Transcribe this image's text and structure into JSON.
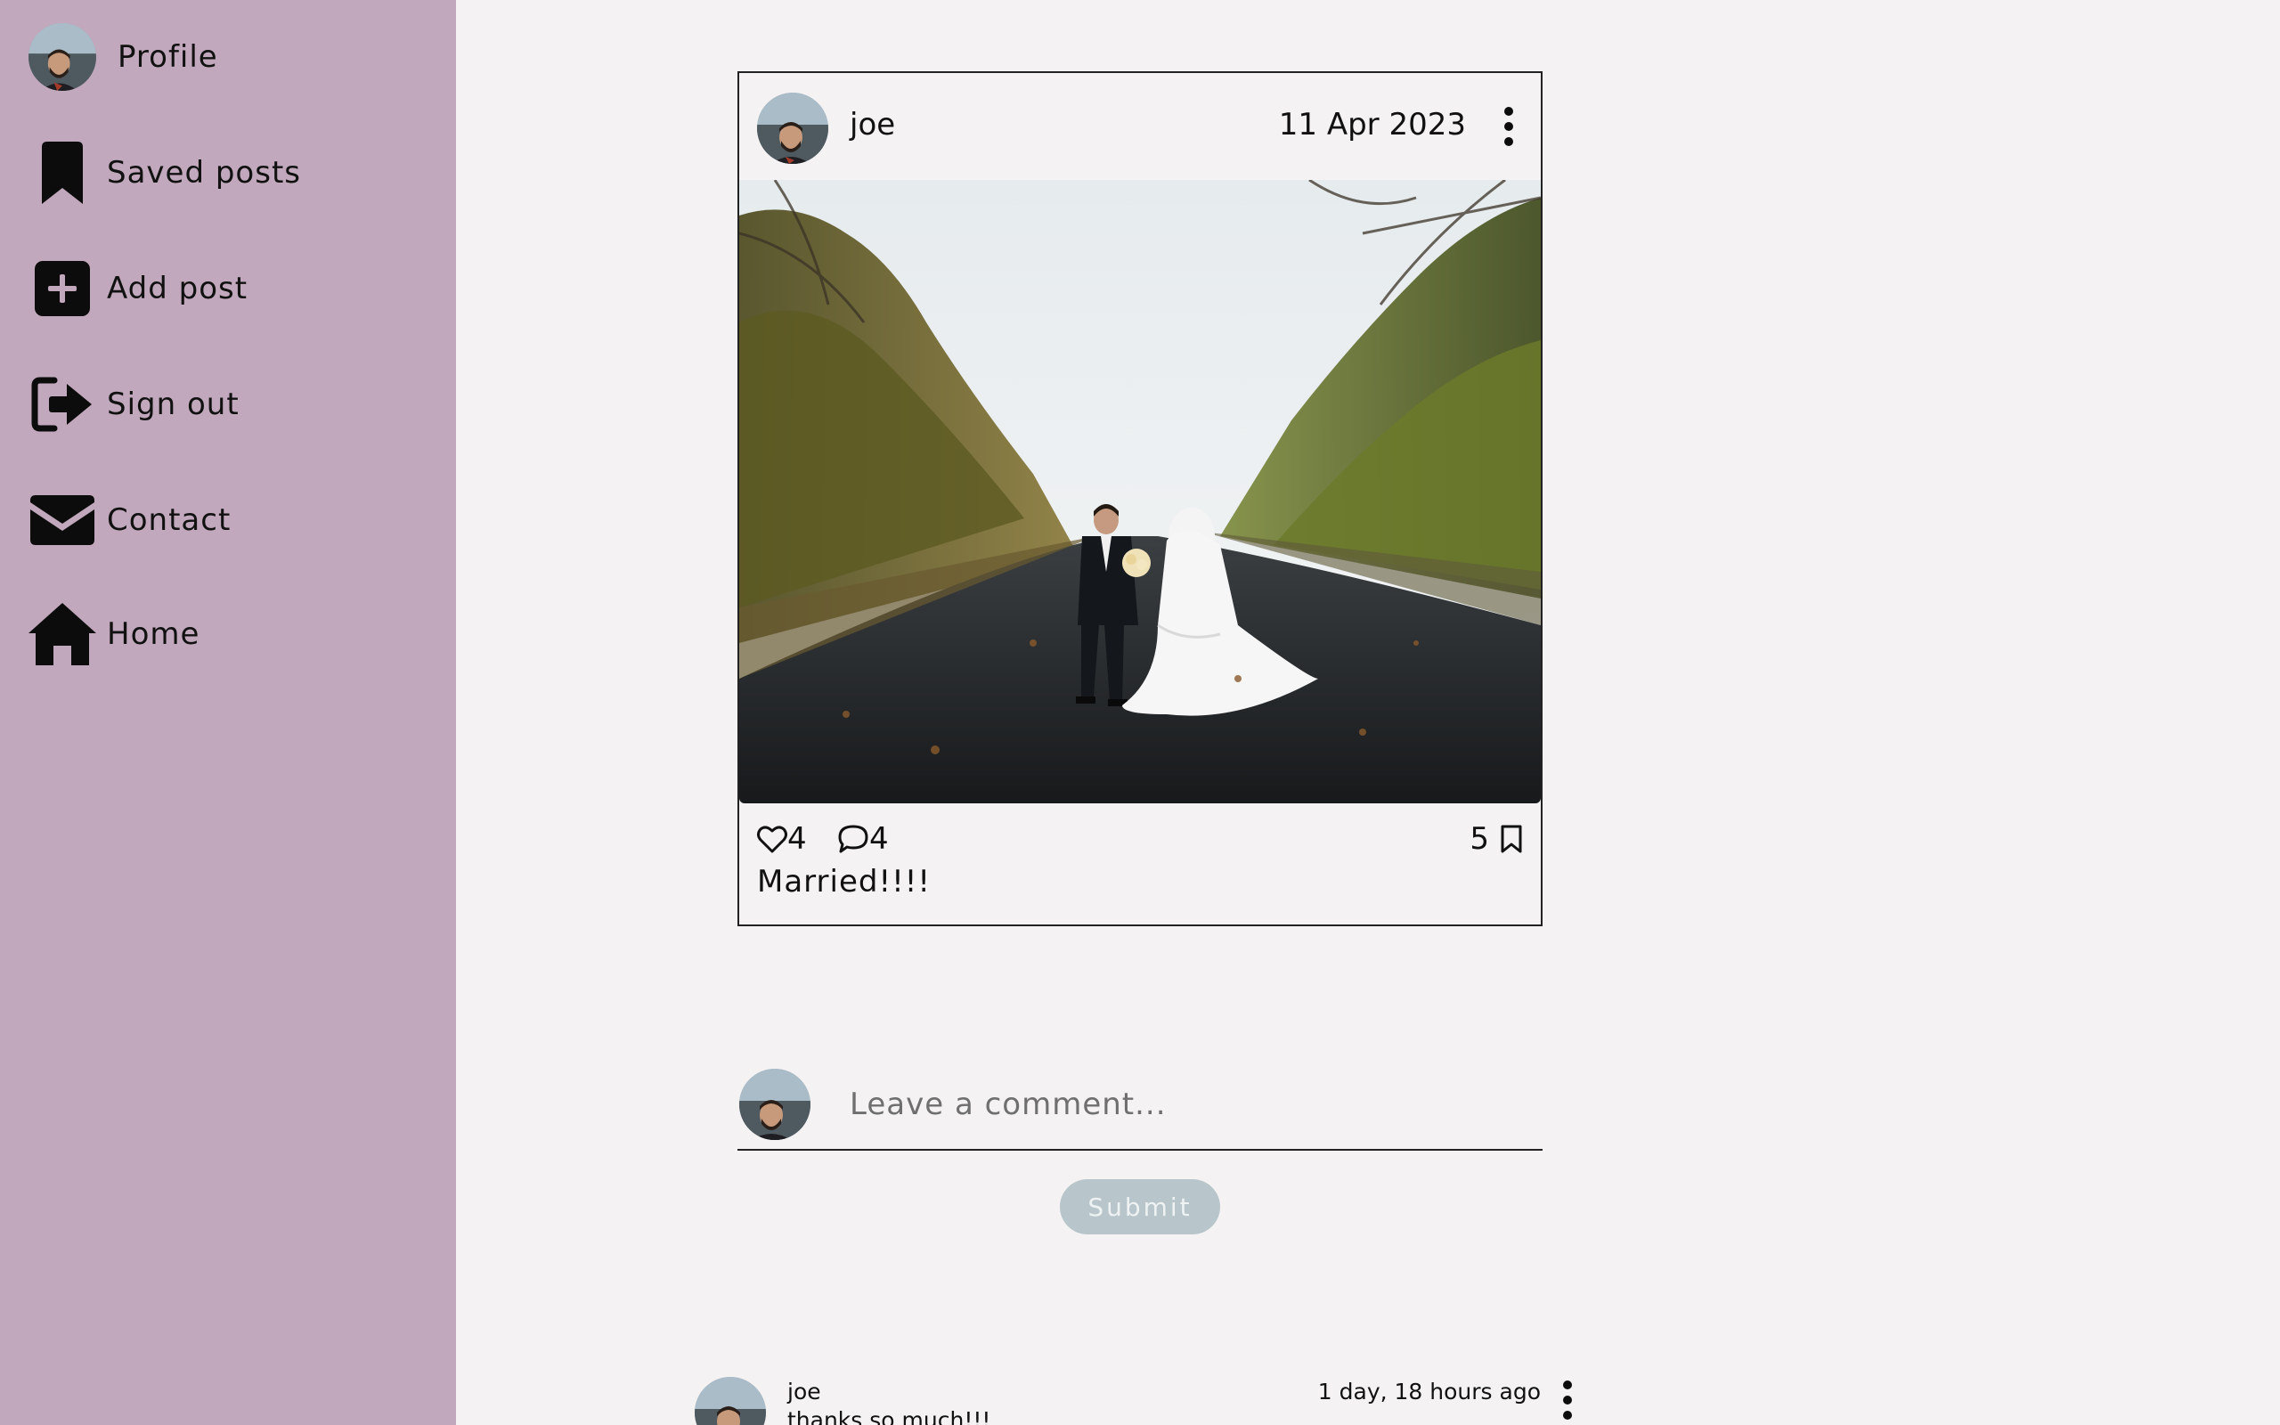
{
  "sidebar": {
    "items": [
      {
        "label": "Profile",
        "icon": "avatar"
      },
      {
        "label": "Saved posts",
        "icon": "bookmark-icon"
      },
      {
        "label": "Add post",
        "icon": "plus-square-icon"
      },
      {
        "label": "Sign out",
        "icon": "sign-out-icon"
      },
      {
        "label": "Contact",
        "icon": "envelope-icon"
      },
      {
        "label": "Home",
        "icon": "home-icon"
      }
    ],
    "background": "#c1a8bc"
  },
  "post": {
    "author": "joe",
    "date": "11 Apr 2023",
    "likes": "4",
    "comments": "4",
    "saves": "5",
    "caption": "Married!!!!"
  },
  "comment_form": {
    "placeholder": "Leave a comment...",
    "submit_label": "Submit"
  },
  "comments": [
    {
      "author": "joe",
      "time": "1 day, 18 hours ago",
      "text": "thanks so much!!!"
    }
  ],
  "colors": {
    "page_bg": "#f4f2f3",
    "sidebar_bg": "#c1a8bc",
    "submit_bg": "#b8c5ca"
  }
}
